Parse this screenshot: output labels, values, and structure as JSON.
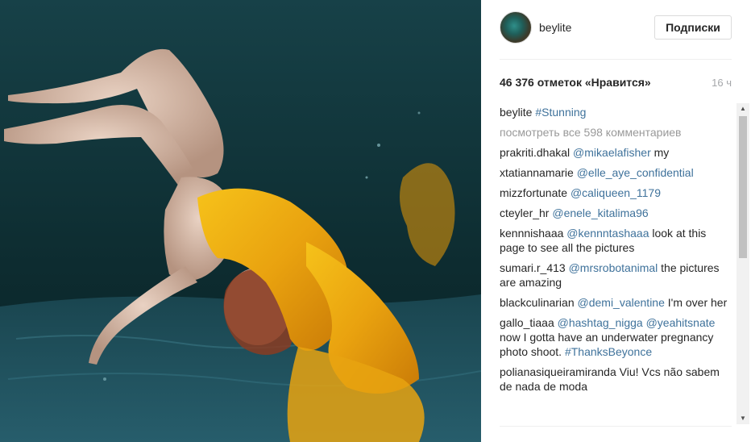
{
  "post": {
    "username": "beylite",
    "follow_label": "Подписки",
    "likes": "46 376 отметок «Нравится»",
    "time": "16 ч",
    "caption": {
      "user": "beylite",
      "text": "#Stunning"
    },
    "view_all": "посмотреть все 598 комментариев"
  },
  "comments": [
    {
      "user": "prakriti.dhakal",
      "parts": [
        {
          "t": "@mikaelafisher",
          "tag": true
        },
        {
          "t": " my",
          "tag": false
        }
      ]
    },
    {
      "user": "xtatiannamarie",
      "parts": [
        {
          "t": "@elle_aye_confidential",
          "tag": true
        }
      ]
    },
    {
      "user": "mizzfortunate",
      "parts": [
        {
          "t": "@caliqueen_1179",
          "tag": true
        }
      ]
    },
    {
      "user": "cteyler_hr",
      "parts": [
        {
          "t": "@enele_kitalima96",
          "tag": true
        }
      ]
    },
    {
      "user": "kennnishaaa",
      "parts": [
        {
          "t": "@kennntashaaa",
          "tag": true
        },
        {
          "t": " look at this page to see all the pictures",
          "tag": false
        }
      ]
    },
    {
      "user": "sumari.r_413",
      "parts": [
        {
          "t": "@mrsrobotanimal",
          "tag": true
        },
        {
          "t": " the pictures are amazing",
          "tag": false
        }
      ]
    },
    {
      "user": "blackculinarian",
      "parts": [
        {
          "t": "@demi_valentine",
          "tag": true
        },
        {
          "t": " I'm over her",
          "tag": false
        }
      ]
    },
    {
      "user": "gallo_tiaaa",
      "parts": [
        {
          "t": "@hashtag_nigga",
          "tag": true
        },
        {
          "t": " ",
          "tag": false
        },
        {
          "t": "@yeahitsnate",
          "tag": true
        },
        {
          "t": " now I gotta have an underwater pregnancy photo shoot. ",
          "tag": false
        },
        {
          "t": "#ThanksBeyonce",
          "tag": true
        }
      ]
    },
    {
      "user": "polianasiqueiramiranda",
      "parts": [
        {
          "t": "Viu! Vcs não sabem de nada de moda",
          "tag": false
        }
      ]
    }
  ],
  "scrollbar": {
    "position": 0
  },
  "icons": {
    "scroll_up": "triangle-up-icon",
    "scroll_down": "triangle-down-icon"
  },
  "colors": {
    "link": "#3f729b",
    "muted": "#999999",
    "text": "#262626"
  }
}
